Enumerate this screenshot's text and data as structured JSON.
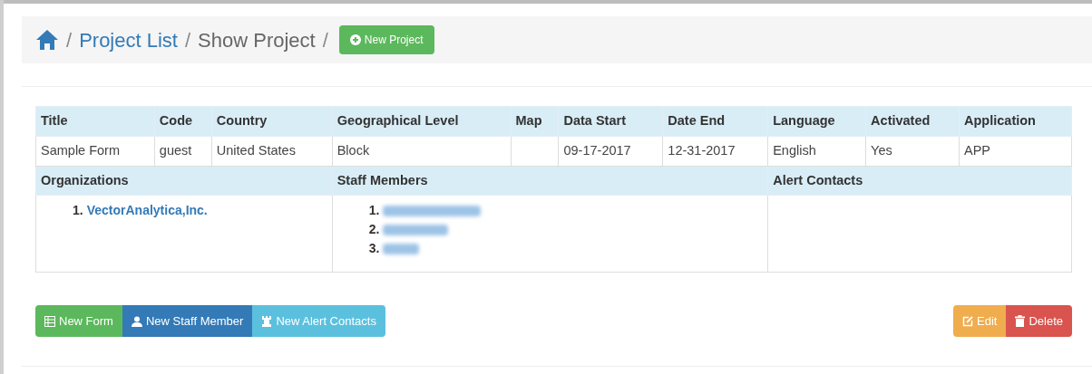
{
  "breadcrumb": {
    "items": [
      {
        "label": "Project List",
        "kind": "link"
      },
      {
        "label": "Show Project",
        "kind": "current"
      }
    ],
    "separator": "/",
    "action": {
      "label": "New Project"
    }
  },
  "project_table": {
    "columns": [
      "Title",
      "Code",
      "Country",
      "Geographical Level",
      "Map",
      "Data Start",
      "Date End",
      "Language",
      "Activated",
      "Application"
    ],
    "row": [
      {
        "kind": "text",
        "text": "Sample Form"
      },
      {
        "kind": "text",
        "text": "guest"
      },
      {
        "kind": "text",
        "text": "United States"
      },
      {
        "kind": "text",
        "text": "Block"
      },
      {
        "kind": "empty"
      },
      {
        "kind": "text",
        "text": "09-17-2017"
      },
      {
        "kind": "text",
        "text": "12-31-2017"
      },
      {
        "kind": "text",
        "text": "English"
      },
      {
        "kind": "text",
        "text": "Yes"
      },
      {
        "kind": "text",
        "text": "APP"
      }
    ]
  },
  "sections": [
    {
      "heading": "Organizations",
      "items": [
        {
          "kind": "link",
          "number": "1.",
          "label": "VectorAnalytica,Inc."
        }
      ]
    },
    {
      "heading": "Staff Members",
      "items": [
        {
          "kind": "redacted",
          "number": "1."
        },
        {
          "kind": "redacted",
          "number": "2."
        },
        {
          "kind": "redacted",
          "number": "3."
        }
      ]
    },
    {
      "heading": "Alert Contacts"
    }
  ],
  "left_buttons": [
    {
      "label": "New Form",
      "kind": "form"
    },
    {
      "label": "New Staff Member",
      "kind": "staff"
    },
    {
      "label": "New Alert Contacts",
      "kind": "alert"
    }
  ],
  "right_buttons": [
    {
      "label": "Edit",
      "kind": "edit"
    },
    {
      "label": "Delete",
      "kind": "delete"
    }
  ]
}
